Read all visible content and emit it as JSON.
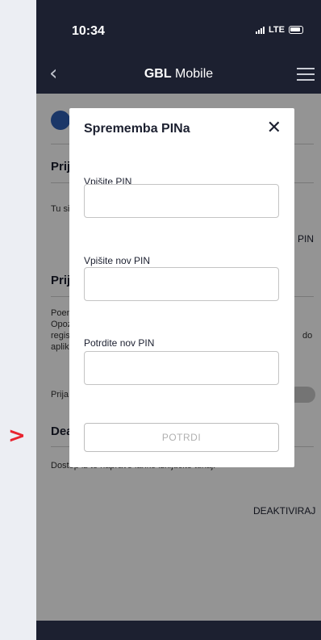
{
  "status_bar": {
    "time": "10:34",
    "network": "LTE"
  },
  "nav": {
    "title_bold": "GBL",
    "title_rest": " Mobile"
  },
  "background": {
    "heading1": "Prij",
    "text1": "Tu si",
    "pin_link": "PIN",
    "heading2": "Prij",
    "text2_l1": "Poen",
    "text2_l2": "Opoz",
    "text2_l3": "regis",
    "text2_l4": "aplik",
    "text2_do": "do",
    "text3": "Prija",
    "heading3": "Dea",
    "text4": "Dostop iz te naprave lahko izključite tukaj.",
    "deactivate": "DEAKTIVIRAJ"
  },
  "modal": {
    "title": "Sprememba PINa",
    "fields": [
      {
        "label": "Vpišite PIN",
        "value": ""
      },
      {
        "label": "Vpišite nov PIN",
        "value": ""
      },
      {
        "label": "Potrdite nov PIN",
        "value": ""
      }
    ],
    "submit_label": "POTRDI"
  }
}
